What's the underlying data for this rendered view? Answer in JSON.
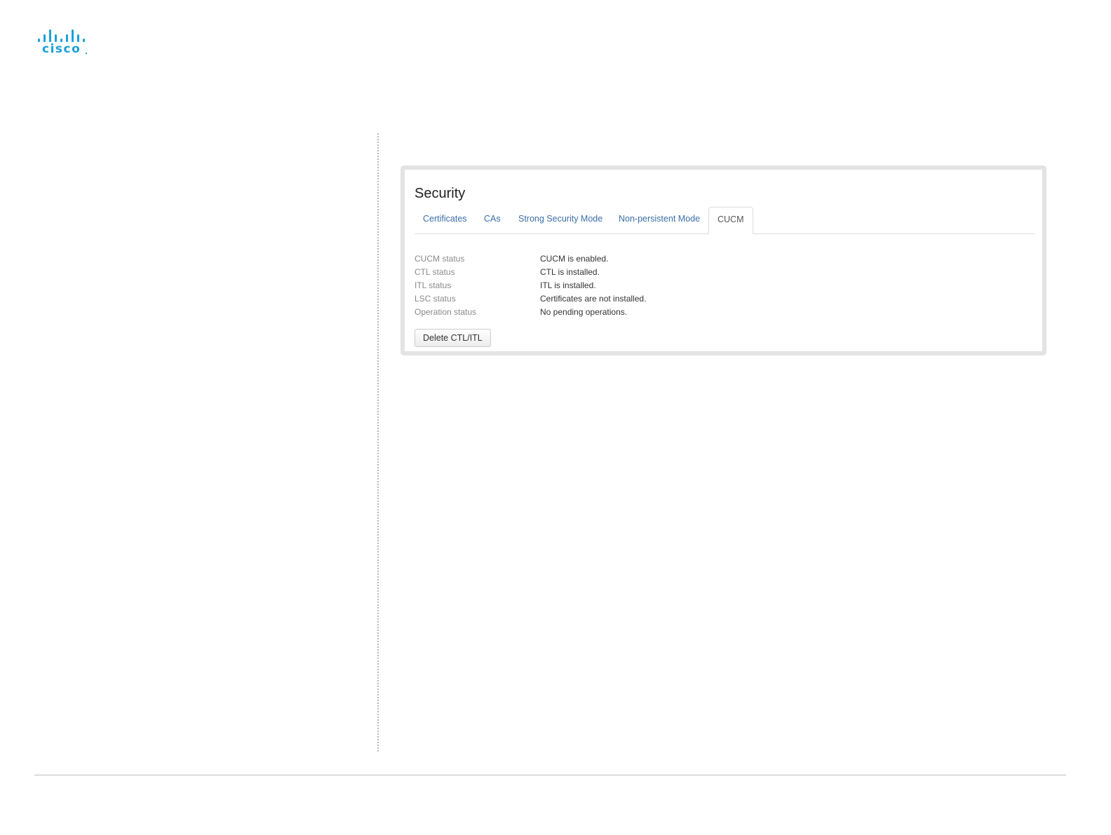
{
  "logo": {
    "wordmark": "cisco",
    "icon": "cisco-bars-icon",
    "color": "#1ba0d7"
  },
  "panel": {
    "title": "Security",
    "tabs": [
      {
        "label": "Certificates",
        "active": false
      },
      {
        "label": "CAs",
        "active": false
      },
      {
        "label": "Strong Security Mode",
        "active": false
      },
      {
        "label": "Non-persistent Mode",
        "active": false
      },
      {
        "label": "CUCM",
        "active": true
      }
    ],
    "status_rows": [
      {
        "label": "CUCM status",
        "value": "CUCM is enabled."
      },
      {
        "label": "CTL status",
        "value": "CTL is installed."
      },
      {
        "label": "ITL status",
        "value": "ITL is installed."
      },
      {
        "label": "LSC status",
        "value": "Certificates are not installed."
      },
      {
        "label": "Operation status",
        "value": "No pending operations."
      }
    ],
    "delete_button_label": "Delete CTL/ITL"
  },
  "colors": {
    "link": "#3a6fa8",
    "label": "#8a8a8a",
    "frame": "#e3e3e3"
  }
}
